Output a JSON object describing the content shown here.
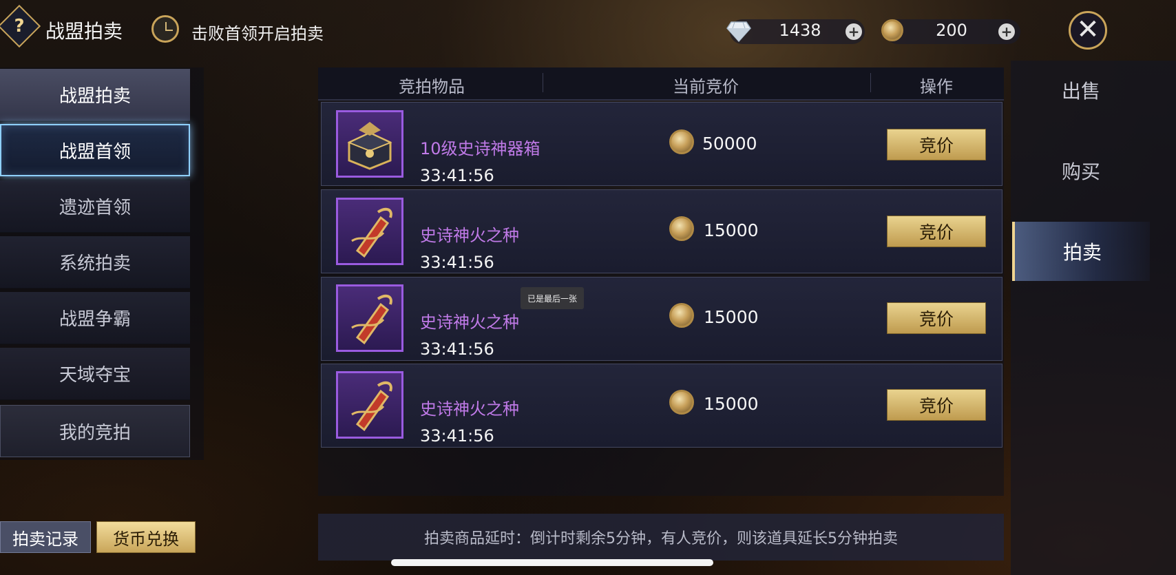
{
  "header": {
    "help_glyph": "?",
    "title": "战盟拍卖",
    "boss_tip": "击败首领开启拍卖",
    "diamond_value": "1438",
    "coin_value": "200",
    "plus_glyph": "+",
    "close_glyph": "✕"
  },
  "left_menu": {
    "items": [
      {
        "label": "战盟拍卖"
      },
      {
        "label": "战盟首领"
      },
      {
        "label": "遗迹首领"
      },
      {
        "label": "系统拍卖"
      },
      {
        "label": "战盟争霸"
      },
      {
        "label": "天域夺宝"
      },
      {
        "label": "我的竞拍"
      }
    ],
    "record_button": "拍卖记录",
    "exchange_button": "货币兑换"
  },
  "table": {
    "headers": [
      "竞拍物品",
      "当前竞价",
      "操作"
    ],
    "rows": [
      {
        "name": "10级史诗神器箱",
        "timer": "33:41:56",
        "price": "50000",
        "action": "竞价",
        "icon": "artifact-chest-icon"
      },
      {
        "name": "史诗神火之种",
        "timer": "33:41:56",
        "price": "15000",
        "action": "竞价",
        "icon": "fire-seed-icon"
      },
      {
        "name": "史诗神火之种",
        "timer": "33:41:56",
        "price": "15000",
        "action": "竞价",
        "icon": "fire-seed-icon"
      },
      {
        "name": "史诗神火之种",
        "timer": "33:41:56",
        "price": "15000",
        "action": "竞价",
        "icon": "fire-seed-icon"
      }
    ]
  },
  "toast": "已是最后一张",
  "notice": "拍卖商品延时：倒计时剩余5分钟，有人竞价，则该道具延长5分钟拍卖",
  "right_tabs": [
    {
      "label": "出售"
    },
    {
      "label": "购买"
    },
    {
      "label": "拍卖"
    }
  ],
  "colors": {
    "accent_gold": "#c9a45a",
    "epic_purple": "#c07ae8",
    "active_glow": "#8fd0ff"
  }
}
